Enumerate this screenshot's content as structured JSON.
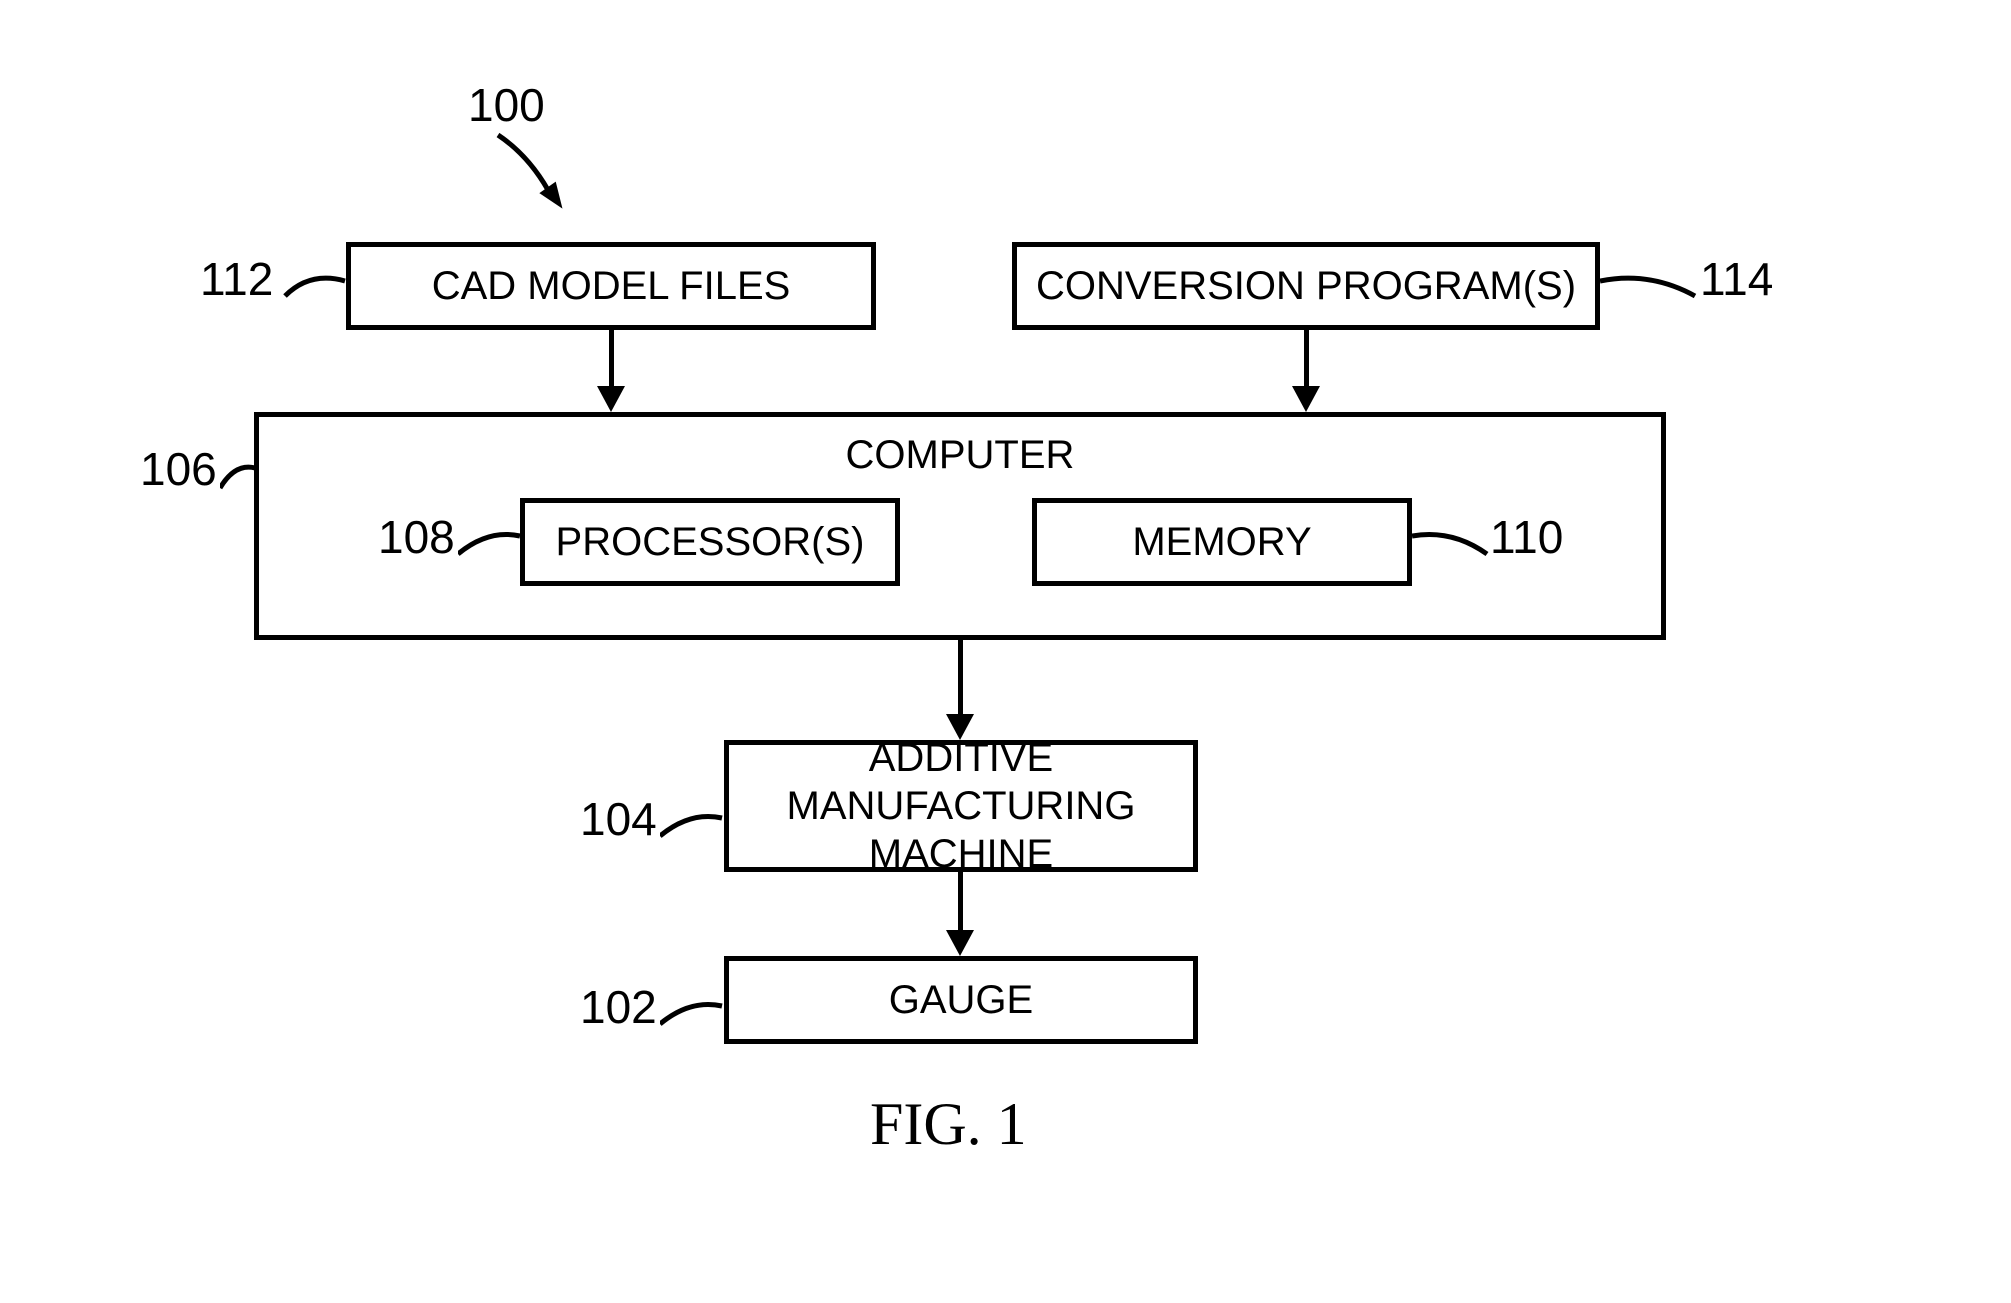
{
  "refs": {
    "r100": "100",
    "r112": "112",
    "r114": "114",
    "r106": "106",
    "r108": "108",
    "r110": "110",
    "r104": "104",
    "r102": "102"
  },
  "blocks": {
    "cad": "CAD MODEL FILES",
    "conv": "CONVERSION PROGRAM(S)",
    "computer": "COMPUTER",
    "proc": "PROCESSOR(S)",
    "mem": "MEMORY",
    "amm": "ADDITIVE MANUFACTURING MACHINE",
    "gauge": "GAUGE"
  },
  "caption": "FIG. 1"
}
